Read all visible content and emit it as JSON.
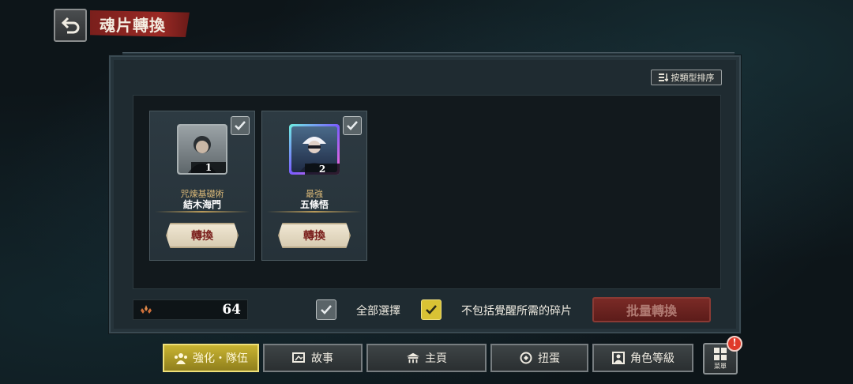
{
  "header": {
    "title": "魂片轉換",
    "back_icon": "back-arrow-icon"
  },
  "sort_button": {
    "label": "按類型排序",
    "icon": "sort-icon"
  },
  "cards": [
    {
      "subtitle": "咒煉基礎術",
      "name": "結木海門",
      "count": "1",
      "convert_label": "轉換",
      "frame": "grey"
    },
    {
      "subtitle": "最強",
      "name": "五條悟",
      "count": "2",
      "convert_label": "轉換",
      "frame": "holo"
    }
  ],
  "currency": {
    "icon": "soul-fragment-icon",
    "amount": "64"
  },
  "select_all": {
    "label": "全部選擇",
    "checked": true
  },
  "exclude_awaken": {
    "label": "不包括覺醒所需的碎片",
    "checked": true
  },
  "batch_convert": {
    "label": "批量轉換"
  },
  "nav": [
    {
      "label": "強化・隊伍",
      "icon": "team-icon",
      "active": true
    },
    {
      "label": "故事",
      "icon": "story-icon",
      "active": false
    },
    {
      "label": "主頁",
      "icon": "home-icon",
      "active": false
    },
    {
      "label": "扭蛋",
      "icon": "gacha-icon",
      "active": false
    },
    {
      "label": "角色等級",
      "icon": "character-level-icon",
      "active": false
    }
  ],
  "menu": {
    "label": "菜單",
    "alert": "!"
  },
  "colors": {
    "accent_red": "#7a1f1c",
    "active_gold": "#c9b432",
    "checkbox_yellow": "#d9c234"
  }
}
